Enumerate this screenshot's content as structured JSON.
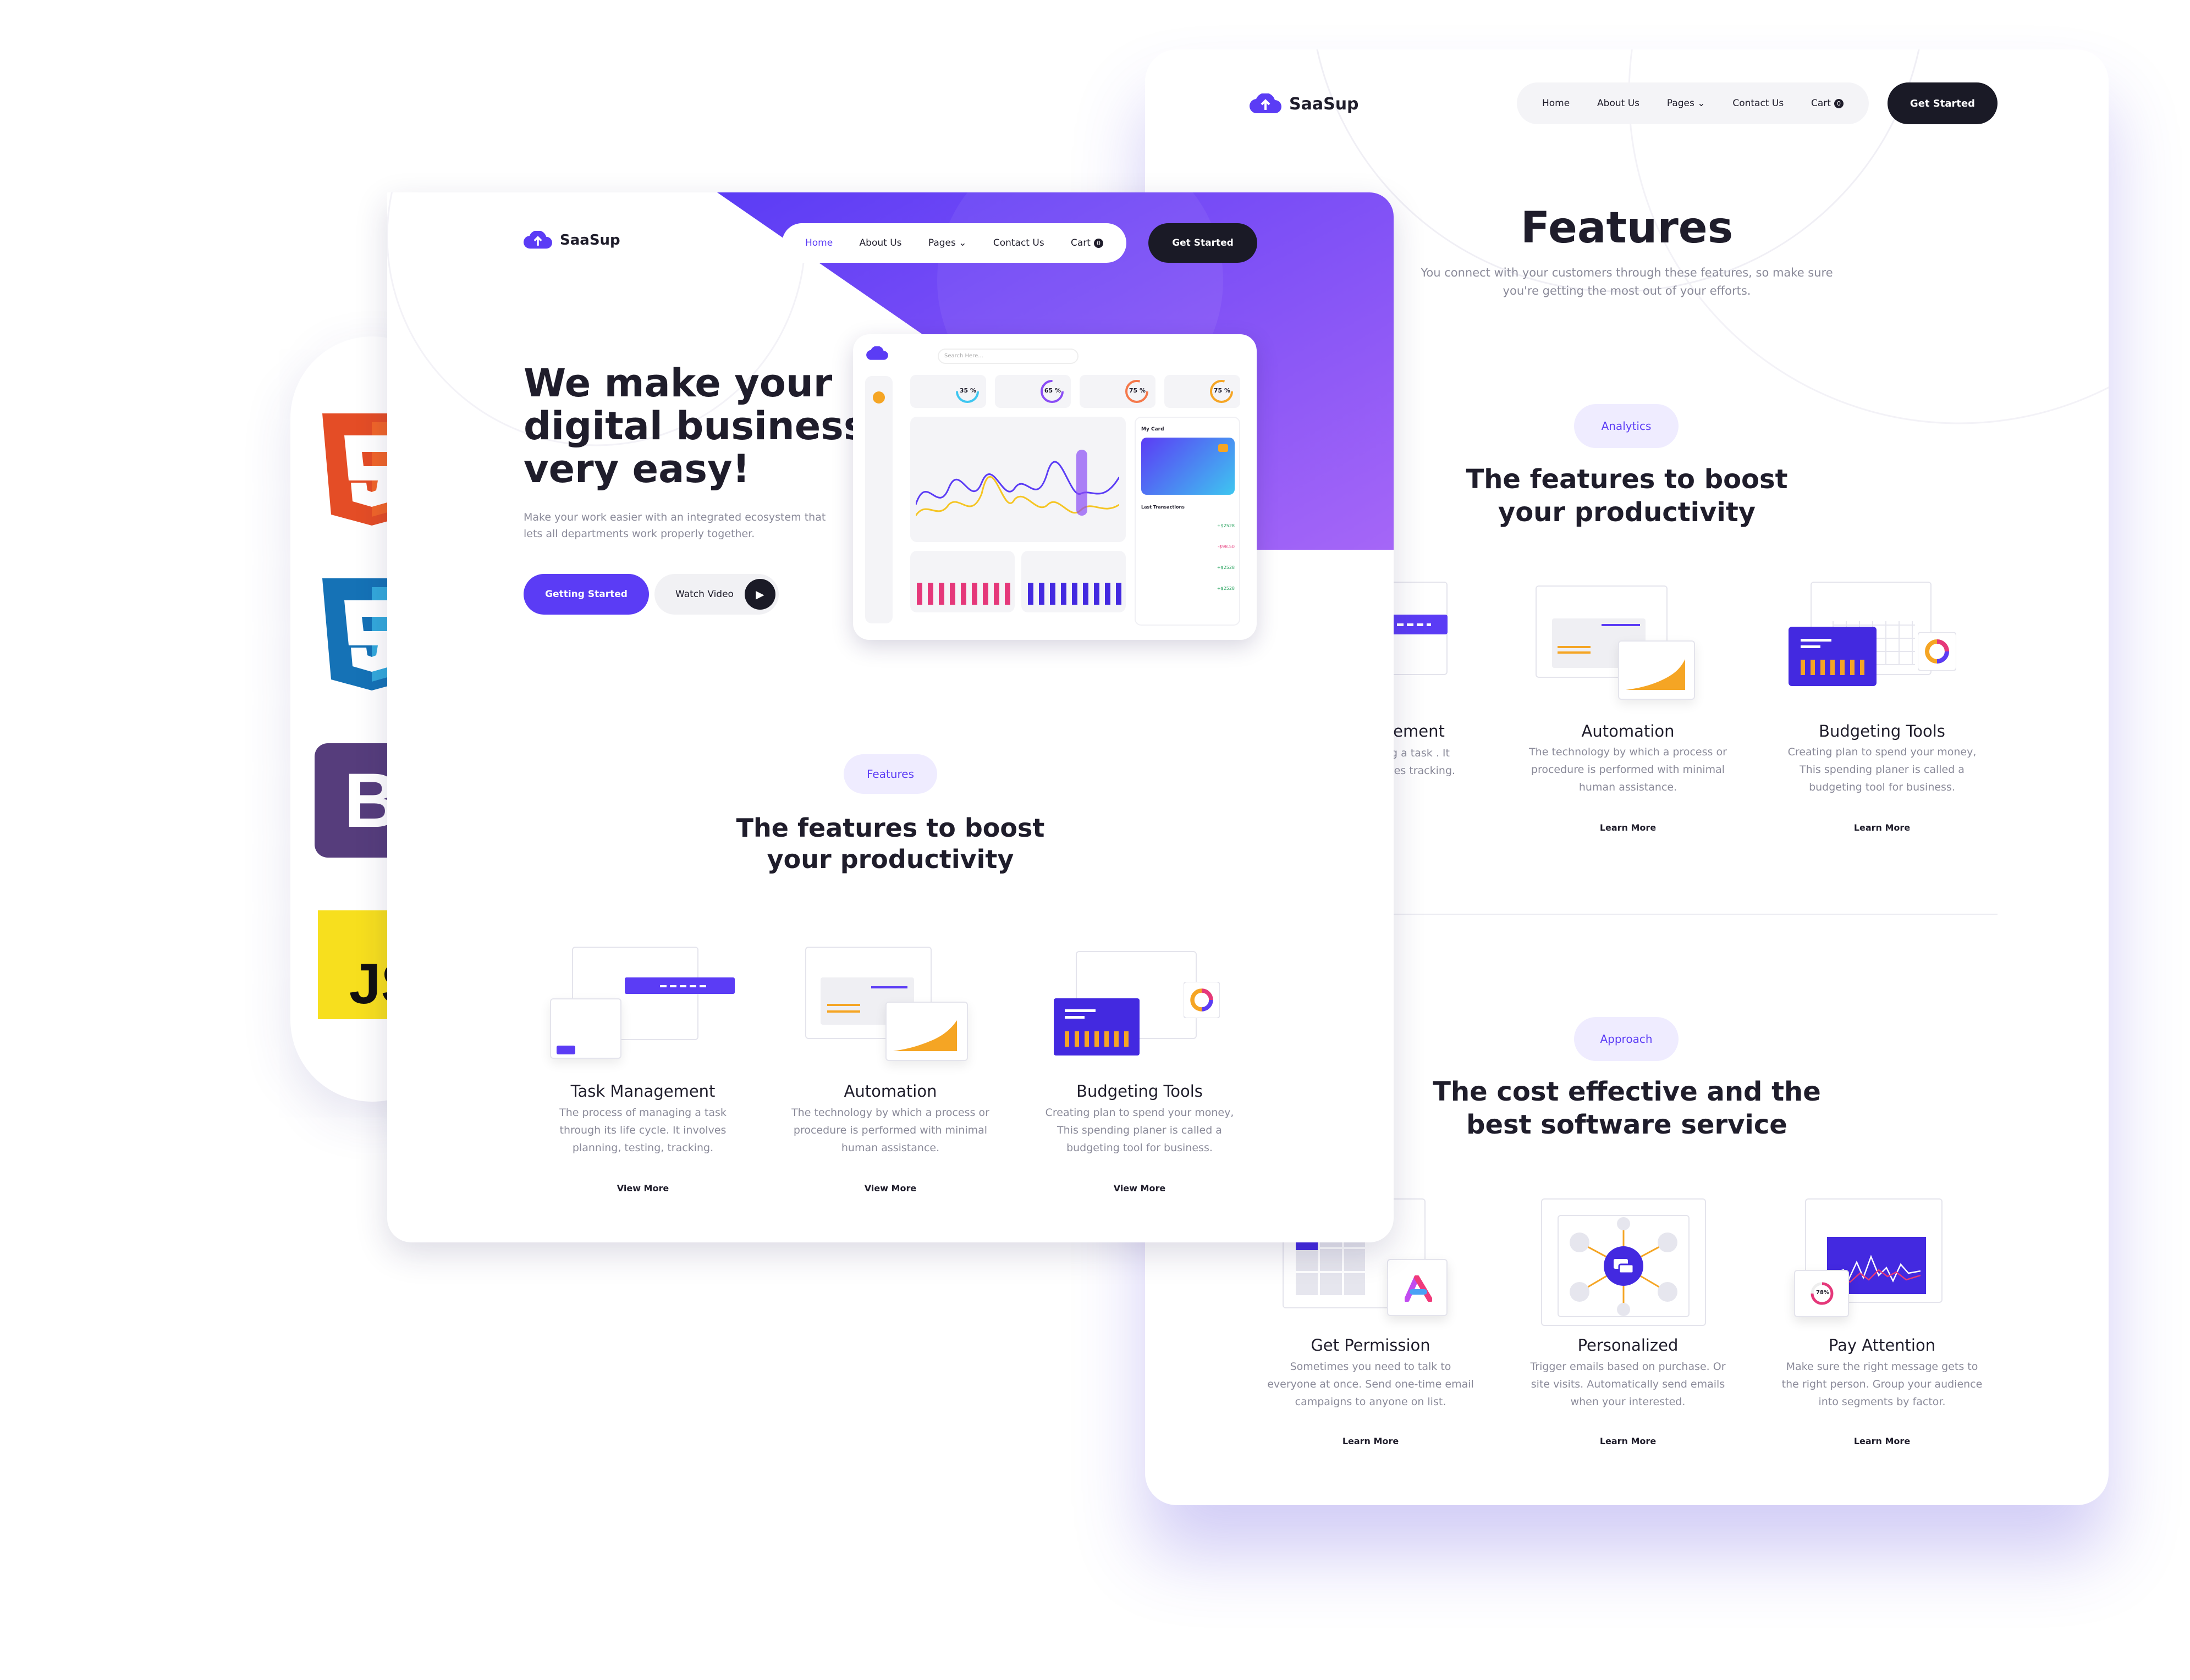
{
  "brand": {
    "name": "SaaSup",
    "primary": "#5b3cf5",
    "dark": "#1a1a26",
    "accent_orange": "#f5a524"
  },
  "tech_badges": [
    {
      "icon": "html5-icon",
      "label": "5"
    },
    {
      "icon": "css3-icon",
      "label": "3"
    },
    {
      "icon": "bootstrap-icon",
      "label": "B"
    },
    {
      "icon": "javascript-icon",
      "label": "JS"
    }
  ],
  "front": {
    "nav": {
      "items": [
        "Home",
        "About Us",
        "Pages",
        "Contact Us",
        "Cart"
      ],
      "cart_count": "0",
      "cta": "Get Started"
    },
    "hero": {
      "title_lines": [
        "We make your",
        "digital business",
        "very easy!"
      ],
      "subtitle": "Make your work easier with an integrated ecosystem that lets all departments work properly together.",
      "primary_button": "Getting Started",
      "secondary_button": "Watch Video"
    },
    "dashboard": {
      "search_placeholder": "Search Here...",
      "gauges": [
        "35 %",
        "65 %",
        "75 %",
        "75 %"
      ],
      "card_label": "My Card",
      "transactions_label": "Last Transactions",
      "transactions": [
        "+$2528",
        "-$98.50",
        "+$2528",
        "+$2528"
      ]
    },
    "features": {
      "pill": "Features",
      "heading_lines": [
        "The features to boost",
        "your productivity"
      ],
      "cards": [
        {
          "title": "Task Management",
          "desc": "The process of managing a task through its life cycle. It involves planning, testing, tracking.",
          "link": "View More"
        },
        {
          "title": "Automation",
          "desc": "The technology by which a process or procedure is performed with minimal human assistance.",
          "link": "View More"
        },
        {
          "title": "Budgeting Tools",
          "desc": "Creating plan to spend your money, This spending planer is called a budgeting tool for business.",
          "link": "View More"
        }
      ]
    }
  },
  "back": {
    "nav": {
      "items": [
        "Home",
        "About Us",
        "Pages",
        "Contact Us",
        "Cart"
      ],
      "cart_count": "0",
      "cta": "Get Started"
    },
    "page_title": "Features",
    "page_subtitle": "You connect with your customers through these  features, so make sure you're getting the most out of your efforts.",
    "analytics": {
      "pill": "Analytics",
      "heading_lines": [
        "The features to boost",
        "your productivity"
      ],
      "cards": [
        {
          "title": "ement",
          "desc": "aging a task . It involves tracking."
        },
        {
          "title": "Automation",
          "desc": "The technology by which a process or procedure is performed with minimal human assistance.",
          "link": "Learn More"
        },
        {
          "title": "Budgeting Tools",
          "desc": "Creating plan to spend your money, This spending planer is called a budgeting tool for business.",
          "link": "Learn More"
        }
      ]
    },
    "approach": {
      "pill": "Approach",
      "heading_lines": [
        "The cost effective and the",
        "best software service"
      ],
      "cards": [
        {
          "title": "Get Permission",
          "desc": "Sometimes you need to talk to everyone at once. Send one-time email campaigns to anyone on list.",
          "link": "Learn More"
        },
        {
          "title": "Personalized",
          "desc": "Trigger emails based on purchase. Or site visits. Automatically send emails when your interested.",
          "link": "Learn More"
        },
        {
          "title": "Pay Attention",
          "desc": "Make sure the right message gets to the right person. Group your audience into segments by factor.",
          "link": "Learn More",
          "badge": "78%"
        }
      ]
    }
  }
}
